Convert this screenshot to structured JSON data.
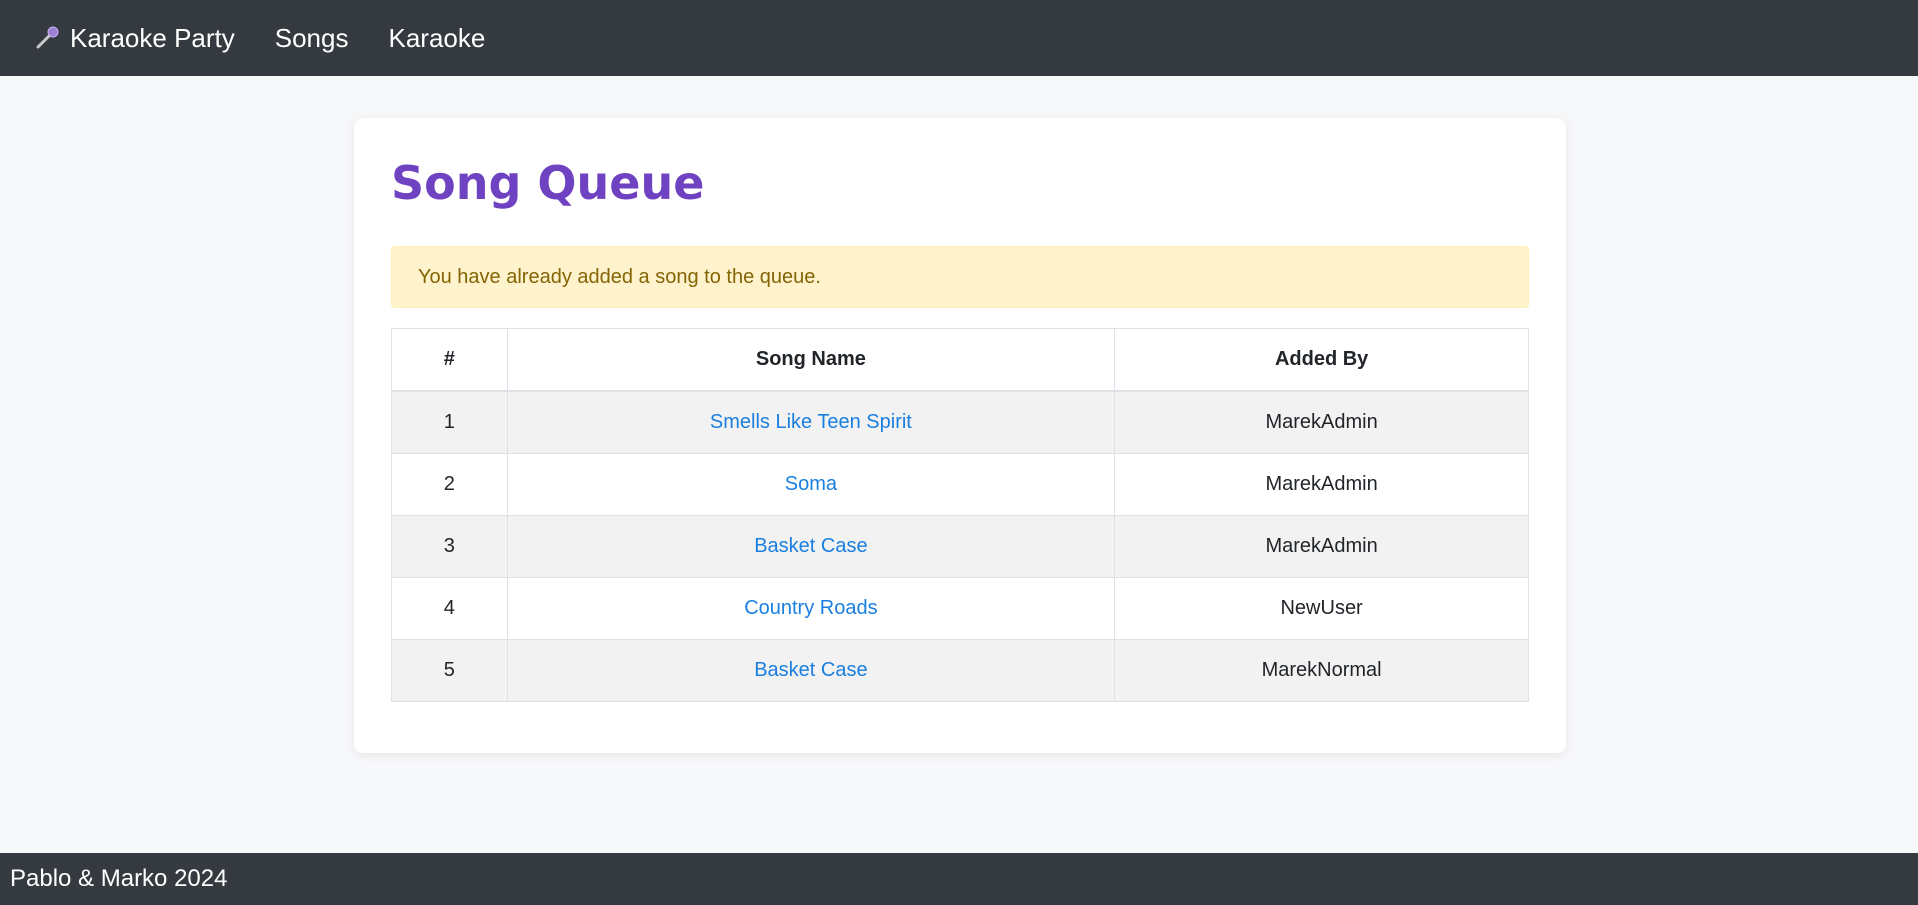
{
  "navbar": {
    "brand_label": "Karaoke Party",
    "brand_icon": "microphone-icon",
    "links": [
      {
        "label": "Songs"
      },
      {
        "label": "Karaoke"
      }
    ]
  },
  "main": {
    "title": "Song Queue",
    "alert": "You have already added a song to the queue.",
    "table": {
      "headers": [
        "#",
        "Song Name",
        "Added By"
      ],
      "rows": [
        {
          "num": "1",
          "song": "Smells Like Teen Spirit",
          "added_by": "MarekAdmin"
        },
        {
          "num": "2",
          "song": "Soma",
          "added_by": "MarekAdmin"
        },
        {
          "num": "3",
          "song": "Basket Case",
          "added_by": "MarekAdmin"
        },
        {
          "num": "4",
          "song": "Country Roads",
          "added_by": "NewUser"
        },
        {
          "num": "5",
          "song": "Basket Case",
          "added_by": "MarekNormal"
        }
      ]
    }
  },
  "footer": {
    "text": "Pablo & Marko 2024"
  },
  "colors": {
    "navbar_bg": "#343a40",
    "title": "#6f42c1",
    "link": "#1a7fe0",
    "alert_bg": "#fff3cd",
    "alert_text": "#856404"
  }
}
